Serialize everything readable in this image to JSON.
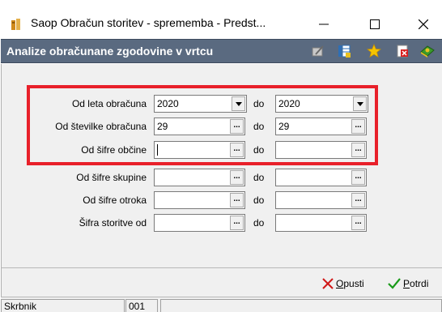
{
  "window": {
    "title": "Saop Obračun storitev - sprememba - Predst...",
    "controls": {
      "minimize": "—",
      "maximize": "☐",
      "close": "✕"
    }
  },
  "header": {
    "title": "Analize obračunane zgodovine v vrtcu",
    "icons": [
      "pencil-icon",
      "grid-icon",
      "star-icon",
      "delete-icon",
      "book-icon"
    ]
  },
  "form": {
    "do_label": "do",
    "rows": [
      {
        "label": "Od leta obračuna",
        "from": "2020",
        "to": "2020",
        "type": "dropdown"
      },
      {
        "label": "Od številke obračuna",
        "from": "29",
        "to": "29",
        "type": "lookup"
      },
      {
        "label": "Od šifre občine",
        "from": "",
        "to": "",
        "type": "lookup"
      },
      {
        "label": "Od šifre skupine",
        "from": "",
        "to": "",
        "type": "lookup"
      },
      {
        "label": "Od šifre otroka",
        "from": "",
        "to": "",
        "type": "lookup"
      },
      {
        "label": "Šifra storitve od",
        "from": "",
        "to": "",
        "type": "lookup"
      }
    ],
    "lookup_glyph": "..."
  },
  "footer": {
    "cancel": {
      "underlined": "O",
      "rest": "pusti"
    },
    "confirm": {
      "underlined": "P",
      "rest": "otrdi"
    },
    "colors": {
      "cancel_icon": "#d01818",
      "confirm_icon": "#1a9a1a"
    }
  },
  "status": {
    "user": "Skrbnik",
    "code": "001"
  },
  "colors": {
    "header_bg": "#5a6a80",
    "highlight": "#e8202a"
  }
}
